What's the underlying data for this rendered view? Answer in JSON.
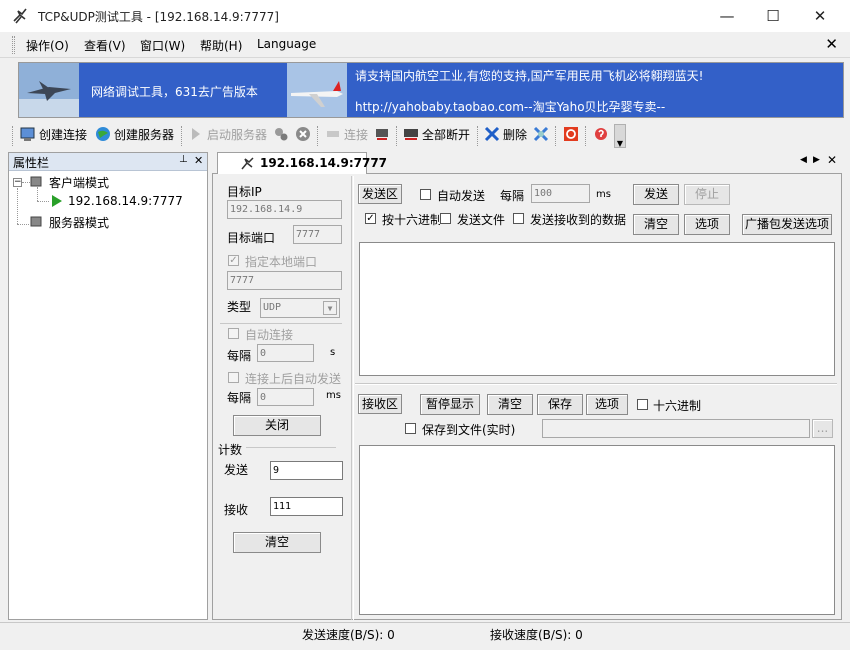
{
  "window": {
    "title": "TCP&UDP测试工具 - [192.168.14.9:7777]"
  },
  "menu": {
    "items": [
      "操作(O)",
      "查看(V)",
      "窗口(W)",
      "帮助(H)",
      "Language"
    ]
  },
  "banner": {
    "ad_text": "网络调试工具，631去广告版本",
    "slogan": "请支持国内航空工业,有您的支持,国产军用民用飞机必将翱翔蓝天!",
    "link_text": "http://yahobaby.taobao.com--淘宝Yaho贝比孕婴专卖--"
  },
  "toolbar": {
    "create_connection": "创建连接",
    "create_server": "创建服务器",
    "start_server": "启动服务器",
    "connect": "连接",
    "disconnect_all": "全部断开",
    "delete": "删除"
  },
  "sidebar": {
    "title": "属性栏",
    "pin_glyph": "⊥",
    "close_glyph": "✕",
    "client_mode": "客户端模式",
    "connection": "192.168.14.9:7777",
    "server_mode": "服务器模式"
  },
  "tab": {
    "label": "192.168.14.9:7777"
  },
  "settings": {
    "target_ip_label": "目标IP",
    "target_ip": "192.168.14.9",
    "target_port_label": "目标端口",
    "target_port": "7777",
    "local_port_label": "指定本地端口",
    "local_port": "7777",
    "type_label": "类型",
    "type_value": "UDP",
    "auto_connect_label": "自动连接",
    "interval1_label": "每隔",
    "interval1_value": "0",
    "interval1_unit": "s",
    "auto_send_label": "连接上后自动发送",
    "interval2_label": "每隔",
    "interval2_value": "0",
    "interval2_unit": "ms",
    "close_button": "关闭",
    "count_label": "计数",
    "send_label": "发送",
    "send_count": "9",
    "recv_label": "接收",
    "recv_count": "111",
    "clear_button": "清空"
  },
  "send_area": {
    "label": "发送区",
    "auto_send": "自动发送",
    "interval_label": "每隔",
    "interval_value": "100",
    "interval_unit": "ms",
    "send_button": "发送",
    "stop_button": "停止",
    "hex_send": "按十六进制",
    "send_file": "发送文件",
    "send_received": "发送接收到的数据",
    "clear_button": "清空",
    "options_button": "选项",
    "broadcast_button": "广播包发送选项"
  },
  "recv_area": {
    "label": "接收区",
    "pause_button": "暂停显示",
    "clear_button": "清空",
    "save_button": "保存",
    "options_button": "选项",
    "hex_label": "十六进制",
    "save_to_file": "保存到文件(实时)",
    "browse_button": "..."
  },
  "status": {
    "send_speed": "发送速度(B/S): 0",
    "recv_speed": "接收速度(B/S): 0"
  }
}
